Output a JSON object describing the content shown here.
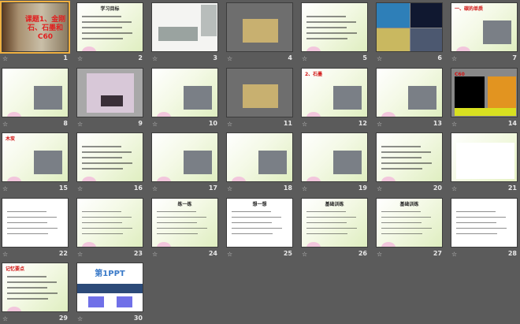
{
  "view": "slide-sorter",
  "slides": [
    {
      "number": "1",
      "title": "课题1、金刚石、石墨和C60",
      "theme": "cover",
      "selected": true
    },
    {
      "number": "2",
      "title": "学习目标",
      "theme": "green"
    },
    {
      "number": "3",
      "title": "",
      "theme": "ink"
    },
    {
      "number": "4",
      "title": "",
      "theme": "photo"
    },
    {
      "number": "5",
      "title": "",
      "theme": "green"
    },
    {
      "number": "6",
      "title": "",
      "theme": "photo4"
    },
    {
      "number": "7",
      "title": "一、碳的单质",
      "theme": "green-img"
    },
    {
      "number": "8",
      "title": "",
      "theme": "green-img"
    },
    {
      "number": "9",
      "title": "",
      "theme": "diamond"
    },
    {
      "number": "10",
      "title": "",
      "theme": "green-img"
    },
    {
      "number": "11",
      "title": "",
      "theme": "photo"
    },
    {
      "number": "12",
      "title": "2、石墨",
      "theme": "green-img"
    },
    {
      "number": "13",
      "title": "",
      "theme": "green-img"
    },
    {
      "number": "14",
      "title": "C60",
      "theme": "c60"
    },
    {
      "number": "15",
      "title": "木炭",
      "theme": "green-img"
    },
    {
      "number": "16",
      "title": "",
      "theme": "green"
    },
    {
      "number": "17",
      "title": "",
      "theme": "green-img"
    },
    {
      "number": "18",
      "title": "",
      "theme": "green-img"
    },
    {
      "number": "19",
      "title": "",
      "theme": "green-img"
    },
    {
      "number": "20",
      "title": "",
      "theme": "green"
    },
    {
      "number": "21",
      "title": "",
      "theme": "table"
    },
    {
      "number": "22",
      "title": "",
      "theme": "white"
    },
    {
      "number": "23",
      "title": "",
      "theme": "green"
    },
    {
      "number": "24",
      "title": "练一练",
      "theme": "green"
    },
    {
      "number": "25",
      "title": "想一想",
      "theme": "white"
    },
    {
      "number": "26",
      "title": "基础训练",
      "theme": "green"
    },
    {
      "number": "27",
      "title": "基础训练",
      "theme": "green"
    },
    {
      "number": "28",
      "title": "",
      "theme": "white"
    },
    {
      "number": "29",
      "title": "记忆要点",
      "theme": "green"
    },
    {
      "number": "30",
      "title": "第1PPT",
      "theme": "brand"
    }
  ],
  "colors": {
    "background": "#5b5b5b",
    "title_red": "#d01010",
    "brand_blue": "#3a7ac8",
    "selection": "#f0b040"
  }
}
